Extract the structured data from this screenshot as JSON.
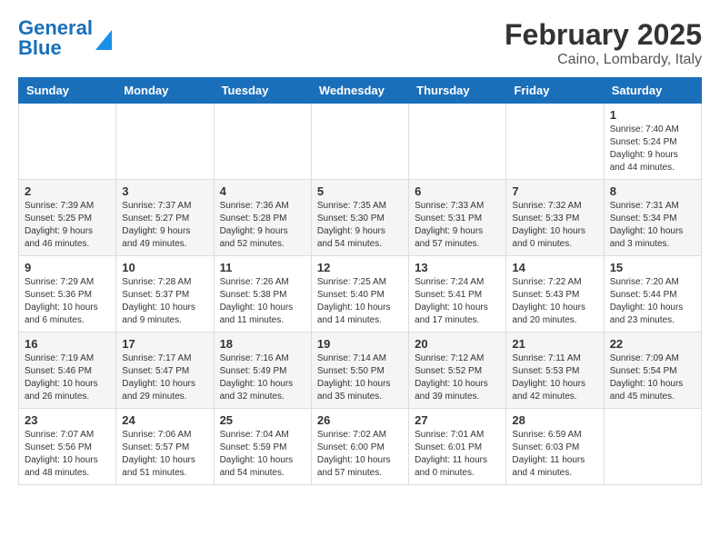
{
  "header": {
    "logo_general": "General",
    "logo_blue": "Blue",
    "month": "February 2025",
    "location": "Caino, Lombardy, Italy"
  },
  "weekdays": [
    "Sunday",
    "Monday",
    "Tuesday",
    "Wednesday",
    "Thursday",
    "Friday",
    "Saturday"
  ],
  "weeks": [
    [
      {
        "day": "",
        "info": ""
      },
      {
        "day": "",
        "info": ""
      },
      {
        "day": "",
        "info": ""
      },
      {
        "day": "",
        "info": ""
      },
      {
        "day": "",
        "info": ""
      },
      {
        "day": "",
        "info": ""
      },
      {
        "day": "1",
        "info": "Sunrise: 7:40 AM\nSunset: 5:24 PM\nDaylight: 9 hours and 44 minutes."
      }
    ],
    [
      {
        "day": "2",
        "info": "Sunrise: 7:39 AM\nSunset: 5:25 PM\nDaylight: 9 hours and 46 minutes."
      },
      {
        "day": "3",
        "info": "Sunrise: 7:37 AM\nSunset: 5:27 PM\nDaylight: 9 hours and 49 minutes."
      },
      {
        "day": "4",
        "info": "Sunrise: 7:36 AM\nSunset: 5:28 PM\nDaylight: 9 hours and 52 minutes."
      },
      {
        "day": "5",
        "info": "Sunrise: 7:35 AM\nSunset: 5:30 PM\nDaylight: 9 hours and 54 minutes."
      },
      {
        "day": "6",
        "info": "Sunrise: 7:33 AM\nSunset: 5:31 PM\nDaylight: 9 hours and 57 minutes."
      },
      {
        "day": "7",
        "info": "Sunrise: 7:32 AM\nSunset: 5:33 PM\nDaylight: 10 hours and 0 minutes."
      },
      {
        "day": "8",
        "info": "Sunrise: 7:31 AM\nSunset: 5:34 PM\nDaylight: 10 hours and 3 minutes."
      }
    ],
    [
      {
        "day": "9",
        "info": "Sunrise: 7:29 AM\nSunset: 5:36 PM\nDaylight: 10 hours and 6 minutes."
      },
      {
        "day": "10",
        "info": "Sunrise: 7:28 AM\nSunset: 5:37 PM\nDaylight: 10 hours and 9 minutes."
      },
      {
        "day": "11",
        "info": "Sunrise: 7:26 AM\nSunset: 5:38 PM\nDaylight: 10 hours and 11 minutes."
      },
      {
        "day": "12",
        "info": "Sunrise: 7:25 AM\nSunset: 5:40 PM\nDaylight: 10 hours and 14 minutes."
      },
      {
        "day": "13",
        "info": "Sunrise: 7:24 AM\nSunset: 5:41 PM\nDaylight: 10 hours and 17 minutes."
      },
      {
        "day": "14",
        "info": "Sunrise: 7:22 AM\nSunset: 5:43 PM\nDaylight: 10 hours and 20 minutes."
      },
      {
        "day": "15",
        "info": "Sunrise: 7:20 AM\nSunset: 5:44 PM\nDaylight: 10 hours and 23 minutes."
      }
    ],
    [
      {
        "day": "16",
        "info": "Sunrise: 7:19 AM\nSunset: 5:46 PM\nDaylight: 10 hours and 26 minutes."
      },
      {
        "day": "17",
        "info": "Sunrise: 7:17 AM\nSunset: 5:47 PM\nDaylight: 10 hours and 29 minutes."
      },
      {
        "day": "18",
        "info": "Sunrise: 7:16 AM\nSunset: 5:49 PM\nDaylight: 10 hours and 32 minutes."
      },
      {
        "day": "19",
        "info": "Sunrise: 7:14 AM\nSunset: 5:50 PM\nDaylight: 10 hours and 35 minutes."
      },
      {
        "day": "20",
        "info": "Sunrise: 7:12 AM\nSunset: 5:52 PM\nDaylight: 10 hours and 39 minutes."
      },
      {
        "day": "21",
        "info": "Sunrise: 7:11 AM\nSunset: 5:53 PM\nDaylight: 10 hours and 42 minutes."
      },
      {
        "day": "22",
        "info": "Sunrise: 7:09 AM\nSunset: 5:54 PM\nDaylight: 10 hours and 45 minutes."
      }
    ],
    [
      {
        "day": "23",
        "info": "Sunrise: 7:07 AM\nSunset: 5:56 PM\nDaylight: 10 hours and 48 minutes."
      },
      {
        "day": "24",
        "info": "Sunrise: 7:06 AM\nSunset: 5:57 PM\nDaylight: 10 hours and 51 minutes."
      },
      {
        "day": "25",
        "info": "Sunrise: 7:04 AM\nSunset: 5:59 PM\nDaylight: 10 hours and 54 minutes."
      },
      {
        "day": "26",
        "info": "Sunrise: 7:02 AM\nSunset: 6:00 PM\nDaylight: 10 hours and 57 minutes."
      },
      {
        "day": "27",
        "info": "Sunrise: 7:01 AM\nSunset: 6:01 PM\nDaylight: 11 hours and 0 minutes."
      },
      {
        "day": "28",
        "info": "Sunrise: 6:59 AM\nSunset: 6:03 PM\nDaylight: 11 hours and 4 minutes."
      },
      {
        "day": "",
        "info": ""
      }
    ]
  ]
}
